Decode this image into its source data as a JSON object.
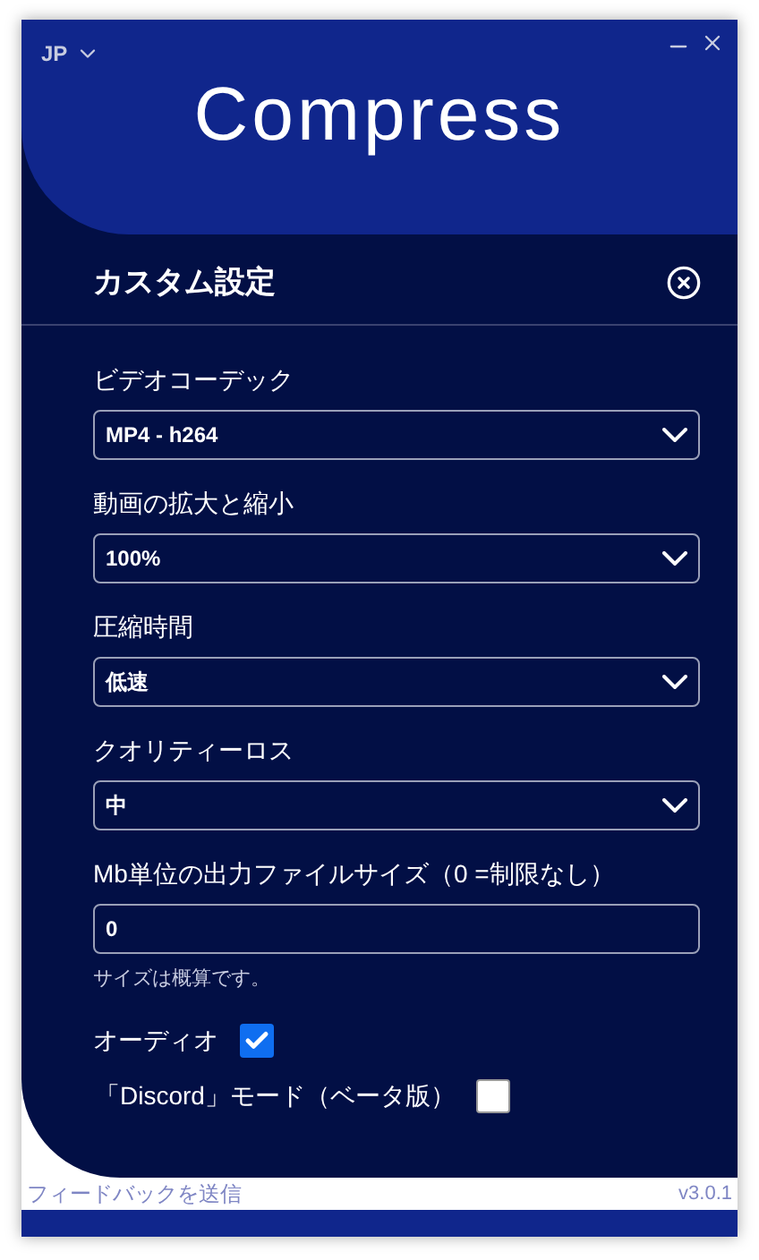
{
  "header": {
    "language": "JP",
    "logo": "Compress"
  },
  "panel": {
    "title": "カスタム設定"
  },
  "fields": [
    {
      "kind": "select",
      "label": "ビデオコーデック",
      "value": "MP4 - h264"
    },
    {
      "kind": "select",
      "label": "動画の拡大と縮小",
      "value": "100%"
    },
    {
      "kind": "select",
      "label": "圧縮時間",
      "value": "低速"
    },
    {
      "kind": "select",
      "label": "クオリティーロス",
      "value": "中"
    },
    {
      "kind": "input",
      "label": "Mb単位の出力ファイルサイズ（0 =制限なし）",
      "value": "0",
      "hint": "サイズは概算です。"
    }
  ],
  "options": [
    {
      "label": "オーディオ",
      "checked": true
    },
    {
      "label": "「Discord」モード（ベータ版）",
      "checked": false
    }
  ],
  "footer": {
    "feedback": "フィードバックを送信",
    "version": "v3.0.1"
  }
}
